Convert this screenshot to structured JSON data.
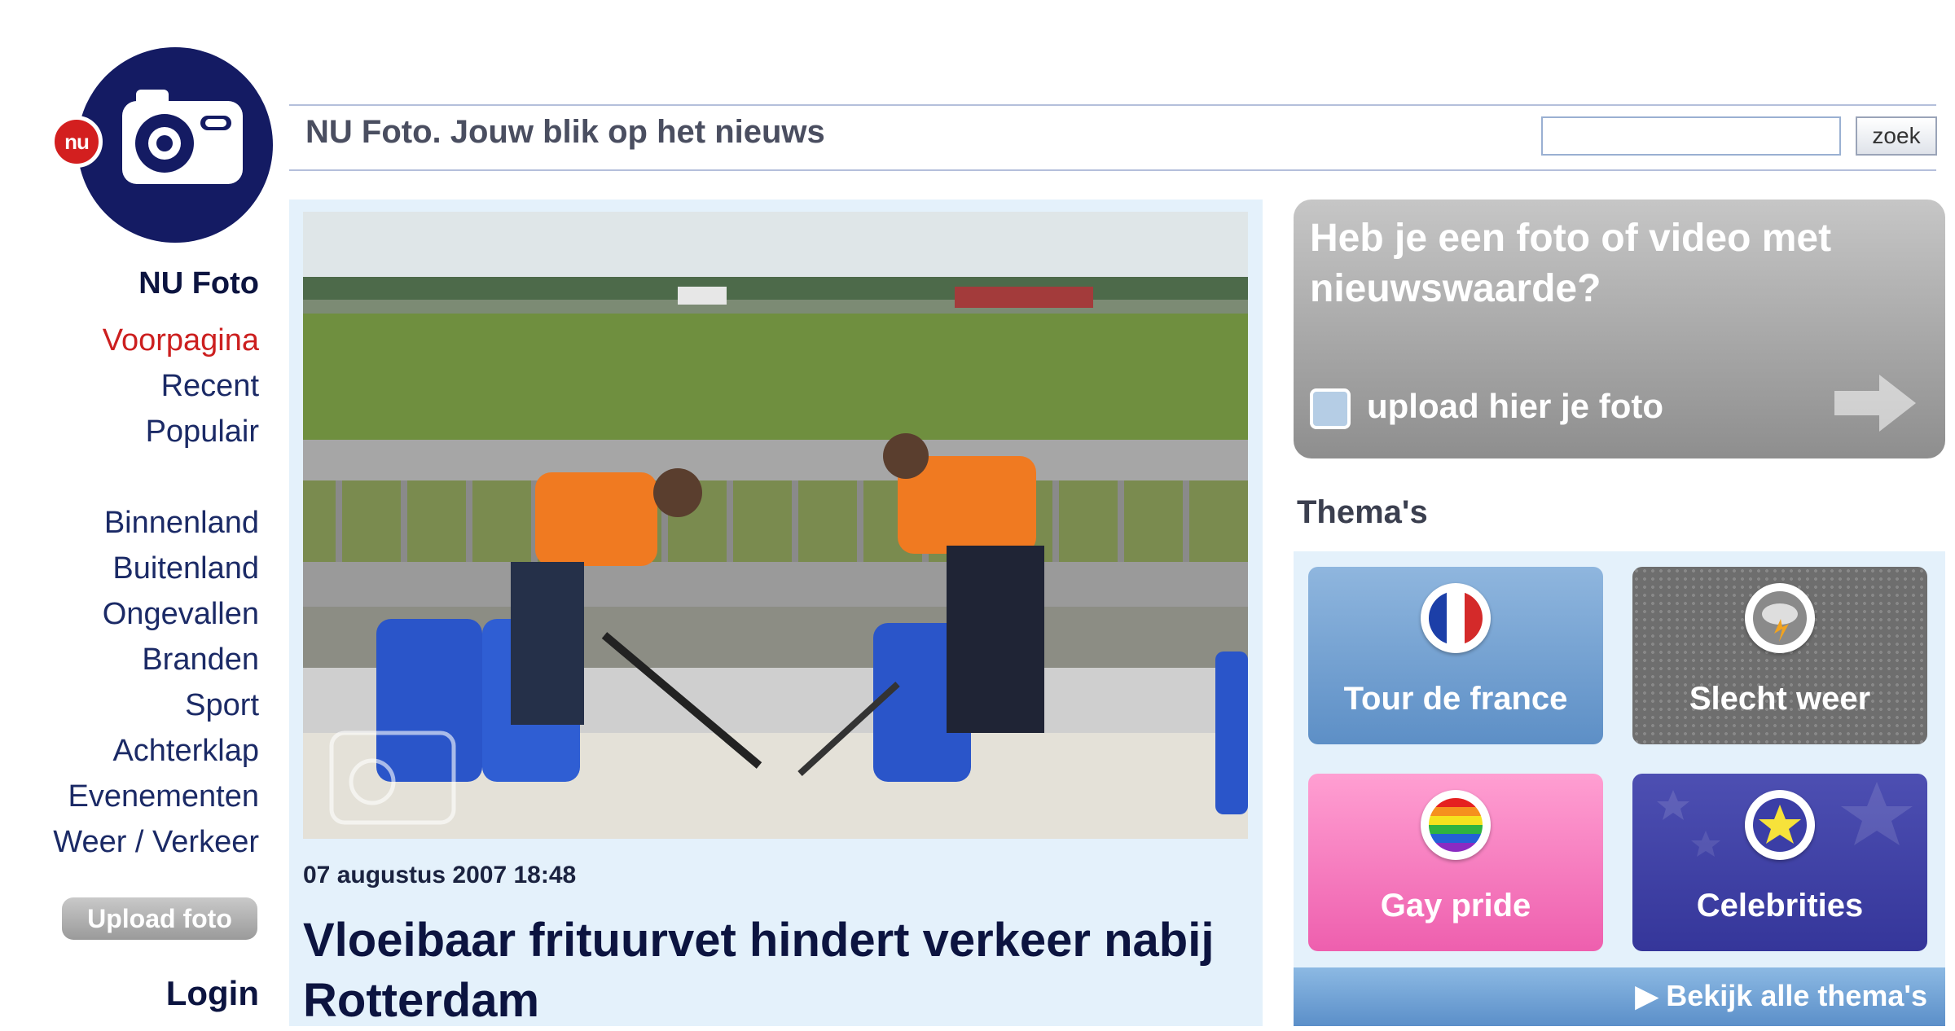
{
  "logo": {
    "badge_text": "nu",
    "icon": "camera-icon"
  },
  "nav": {
    "title": "NU Foto",
    "items_top": [
      "Voorpagina",
      "Recent",
      "Populair"
    ],
    "items_sections": [
      "Binnenland",
      "Buitenland",
      "Ongevallen",
      "Branden",
      "Sport",
      "Achterklap",
      "Evenementen",
      "Weer / Verkeer"
    ],
    "upload_button": "Upload foto",
    "login": "Login"
  },
  "header": {
    "title": "NU Foto. Jouw blik op het nieuws",
    "search_value": "",
    "search_button": "zoek"
  },
  "article": {
    "date": "07 augustus 2007 18:48",
    "title": "Vloeibaar frituurvet hindert verkeer nabij Rotterdam"
  },
  "promo": {
    "text": "Heb je een foto of video met nieuwswaarde?",
    "upload_label": "upload hier je foto",
    "arrow_icon": "arrow-right-icon"
  },
  "themes": {
    "heading": "Thema's",
    "tiles": [
      {
        "label": "Tour de france",
        "icon": "french-flag-icon"
      },
      {
        "label": "Slecht weer",
        "icon": "storm-cloud-icon"
      },
      {
        "label": "Gay pride",
        "icon": "rainbow-flag-icon"
      },
      {
        "label": "Celebrities",
        "icon": "star-icon"
      }
    ],
    "all_link": "▶ Bekijk alle thema's"
  },
  "colors": {
    "brand_navy": "#141b63",
    "nu_red": "#d31f1f",
    "active_nav": "#cc1f1f",
    "panel_bg": "#e4f1fb"
  }
}
